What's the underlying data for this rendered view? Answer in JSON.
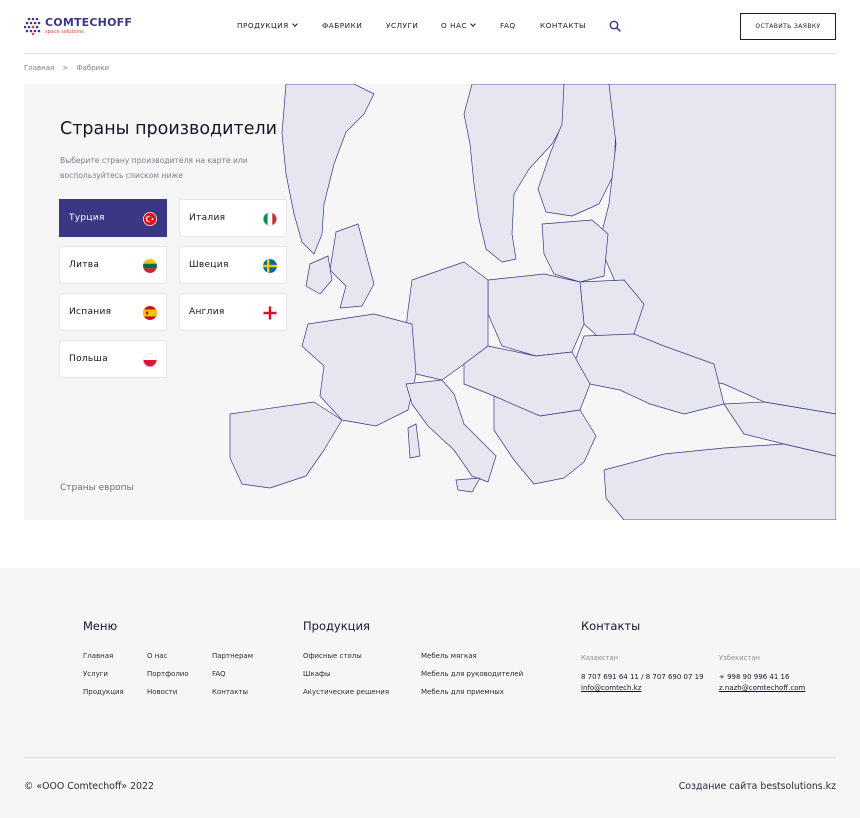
{
  "header": {
    "logo_name": "COMTECHOFF",
    "logo_tag": "space solutions",
    "nav": [
      {
        "label": "ПРОДУКЦИЯ",
        "has_dropdown": true
      },
      {
        "label": "ФАБРИКИ",
        "has_dropdown": false
      },
      {
        "label": "УСЛУГИ",
        "has_dropdown": false
      },
      {
        "label": "О НАС",
        "has_dropdown": true
      },
      {
        "label": "FAQ",
        "has_dropdown": false
      },
      {
        "label": "КОНТАКТЫ",
        "has_dropdown": false
      }
    ],
    "search_icon": "search-icon",
    "cta_label": "ОСТАВИТЬ ЗАЯВКУ"
  },
  "breadcrumb": {
    "home": "Главная",
    "separator": ">",
    "current": "Фабрики"
  },
  "map": {
    "title": "Страны производители",
    "subtitle": "Выберите страну производителя на карте или воспользуйтесь списком ниже",
    "countries": [
      {
        "name": "Турция",
        "flag": "turkey-flag",
        "active": true
      },
      {
        "name": "Италия",
        "flag": "italy-flag",
        "active": false
      },
      {
        "name": "Литва",
        "flag": "lithuania-flag",
        "active": false
      },
      {
        "name": "Швеция",
        "flag": "sweden-flag",
        "active": false
      },
      {
        "name": "Испания",
        "flag": "spain-flag",
        "active": false
      },
      {
        "name": "Англия",
        "flag": "england-flag",
        "active": false
      },
      {
        "name": "Польша",
        "flag": "poland-flag",
        "active": false
      }
    ],
    "note": "Страны европы"
  },
  "footer": {
    "menu": {
      "heading": "Меню",
      "links": [
        "Главная",
        "О нас",
        "Партнерам",
        "Услуги",
        "Портфолио",
        "FAQ",
        "Продукция",
        "Новости",
        "Контакты"
      ]
    },
    "products": {
      "heading": "Продукция",
      "links": [
        "Офисные столы",
        "Мебель мягкая",
        "Шкафы",
        "Мебель для руководителей",
        "Акустические решения",
        "Мебель для приемных"
      ]
    },
    "contacts": {
      "heading": "Контакты",
      "kz": {
        "country": "Казахстан",
        "phone": "8 707 691 64 11 / 8 707 690 07 19",
        "email": "info@comtech.kz"
      },
      "uz": {
        "country": "Узбекистан",
        "phone": "+ 998 90 996 41 16",
        "email": "z.nazh@comtechoff.com"
      }
    },
    "copyright": "© «ООО Comtechoff» 2022",
    "credit": "Создание сайта bestsolutions.kz"
  },
  "colors": {
    "accent": "#3a3784",
    "logo_tag": "#d9443b",
    "map_land": "#e6e6f0",
    "map_border": "#3a3784",
    "section_bg": "#f6f6f6"
  }
}
